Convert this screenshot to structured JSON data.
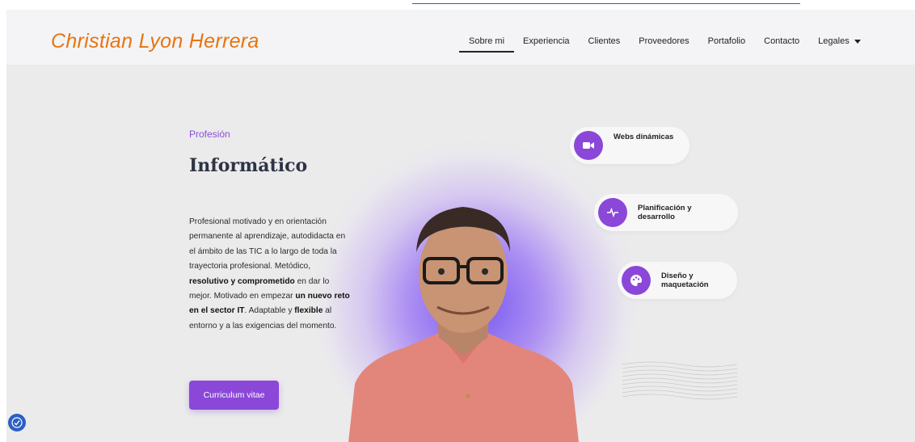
{
  "site": {
    "brand": "Christian Lyon Herrera"
  },
  "nav": {
    "items": [
      {
        "label": "Sobre mi",
        "active": true
      },
      {
        "label": "Experiencia"
      },
      {
        "label": "Clientes"
      },
      {
        "label": "Proveedores"
      },
      {
        "label": "Portafolio"
      },
      {
        "label": "Contacto"
      },
      {
        "label": "Legales",
        "dropdown": true
      }
    ]
  },
  "hero": {
    "profession_label": "Profesión",
    "title": "Informático",
    "description_parts": [
      {
        "text": "Profesional motivado y en orientación permanente al aprendizaje, autodidacta en el ámbito de las TIC a lo largo de toda la trayectoria profesional. Metódico, "
      },
      {
        "text": "resolutivo y comprometido",
        "bold": true
      },
      {
        "text": " en dar lo mejor. Motivado en empezar "
      },
      {
        "text": "un nuevo reto en el sector IT",
        "bold": true
      },
      {
        "text": ". Adaptable y "
      },
      {
        "text": "flexible",
        "bold": true
      },
      {
        "text": " al entorno y a las exigencias del momento."
      }
    ],
    "cv_button": "Curriculum vitae"
  },
  "features": [
    {
      "label": "Webs dinámicas",
      "icon": "video-camera-icon"
    },
    {
      "label": "Planificación y desarrollo",
      "icon": "pulse-wave-icon"
    },
    {
      "label": "Diseño y maquetación",
      "icon": "palette-icon"
    }
  ],
  "colors": {
    "brand": "#e8740f",
    "accent": "#8a47d8",
    "title": "#2e3445",
    "accessibility": "#2c5fc4"
  },
  "accessibility": {
    "icon": "accessibility-icon"
  }
}
